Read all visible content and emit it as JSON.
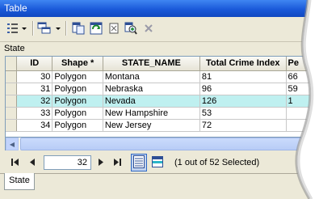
{
  "window": {
    "title": "Table"
  },
  "toolbar": {
    "icons": [
      "table-options-icon",
      "related-tables-icon",
      "select-by-attributes-icon",
      "switch-selection-icon",
      "clear-selection-icon",
      "zoom-to-selected-icon",
      "delete-selected-icon"
    ]
  },
  "table_label": "State",
  "grid": {
    "columns": [
      "",
      "ID",
      "Shape *",
      "STATE_NAME",
      "Total Crime Index",
      "Pe"
    ],
    "rows": [
      {
        "id": "30",
        "shape": "Polygon",
        "state_name": "Montana",
        "crime_index": "81",
        "pe": "66"
      },
      {
        "id": "31",
        "shape": "Polygon",
        "state_name": "Nebraska",
        "crime_index": "96",
        "pe": "59"
      },
      {
        "id": "32",
        "shape": "Polygon",
        "state_name": "Nevada",
        "crime_index": "126",
        "pe": "1"
      },
      {
        "id": "33",
        "shape": "Polygon",
        "state_name": "New Hampshire",
        "crime_index": "53",
        "pe": ""
      },
      {
        "id": "34",
        "shape": "Polygon",
        "state_name": "New Jersey",
        "crime_index": "72",
        "pe": ""
      }
    ],
    "selected_row_index": 2
  },
  "navigation": {
    "current_record": "32",
    "selection_status": "(1 out of 52 Selected)"
  },
  "tabs": [
    {
      "label": "State"
    }
  ],
  "colors": {
    "title_bar": "#1a59d9",
    "selected_row": "#bff0f0",
    "chrome": "#ece9d8"
  }
}
